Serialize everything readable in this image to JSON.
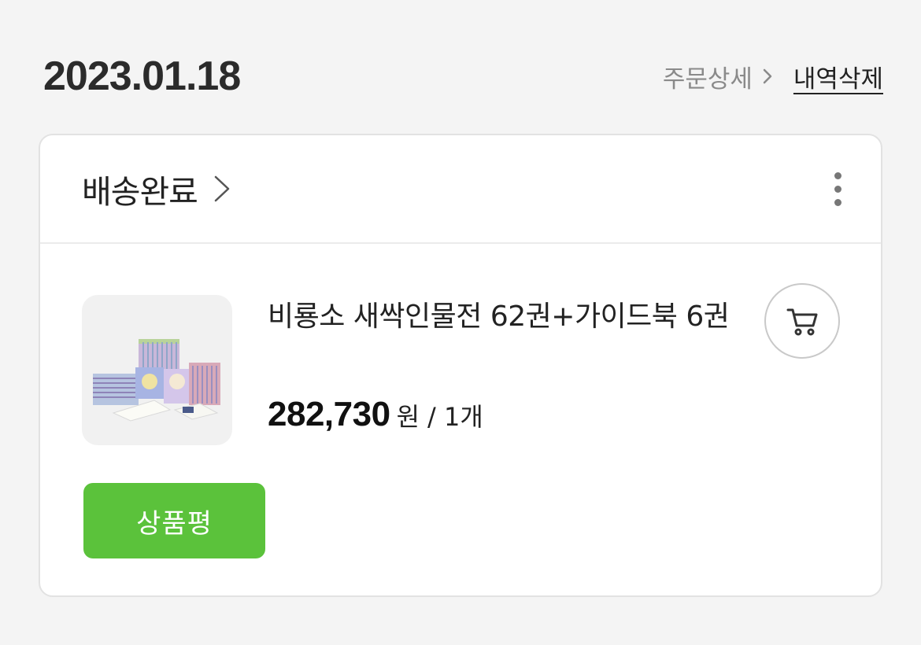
{
  "order": {
    "date": "2023.01.18",
    "detail_label": "주문상세",
    "delete_label": "내역삭제"
  },
  "card": {
    "status": "배송완료",
    "product": {
      "name": "비룡소 새싹인물전 62권+가이드북 6권",
      "price": "282,730",
      "price_unit": "원",
      "quantity": "/ 1개",
      "image_icon": "book-set-image"
    },
    "review_label": "상품평"
  },
  "colors": {
    "accent_green": "#5bc23b",
    "background": "#f4f4f4"
  }
}
